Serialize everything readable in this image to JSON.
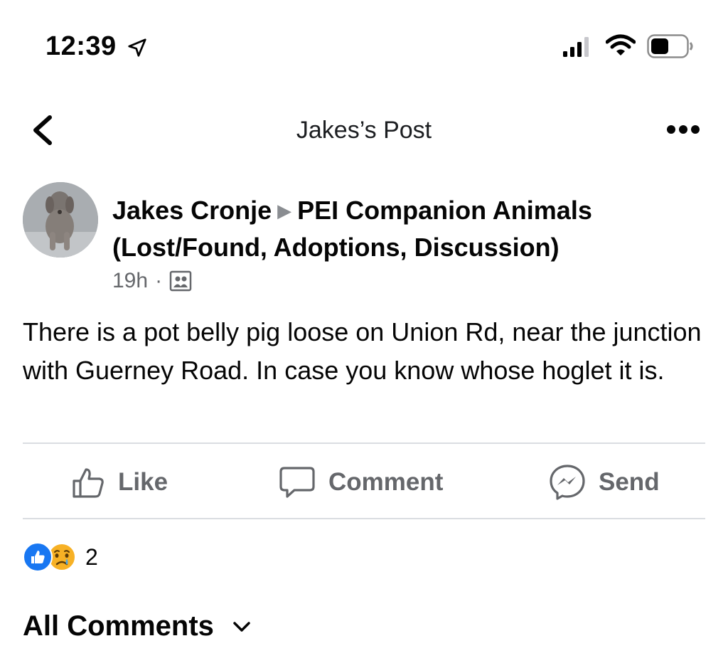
{
  "status_bar": {
    "time": "12:39",
    "icons": [
      "location-arrow-icon",
      "cell-signal-icon",
      "wifi-icon",
      "battery-icon"
    ]
  },
  "nav": {
    "title": "Jakes’s Post",
    "icons": [
      "back-chevron-icon",
      "more-options-icon"
    ]
  },
  "post": {
    "author": "Jakes Cronje",
    "separator_icon": "right-triangle-icon",
    "group": "PEI Companion Animals (Lost/Found, Adoptions, Discussion)",
    "time_ago": "19h",
    "meta_dot": "·",
    "audience_icon": "group-members-icon",
    "text": "There is a pot belly pig loose on Union Rd, near the junction with Guerney Road. In case you know whose hoglet it is."
  },
  "actions": {
    "like": "Like",
    "comment": "Comment",
    "send": "Send"
  },
  "reactions": {
    "types": [
      "like",
      "sad"
    ],
    "count": "2"
  },
  "comments": {
    "filter_label": "All Comments"
  },
  "colors": {
    "facebook_blue": "#1877f2",
    "secondary_text": "#65676b",
    "divider": "#dadde1"
  }
}
